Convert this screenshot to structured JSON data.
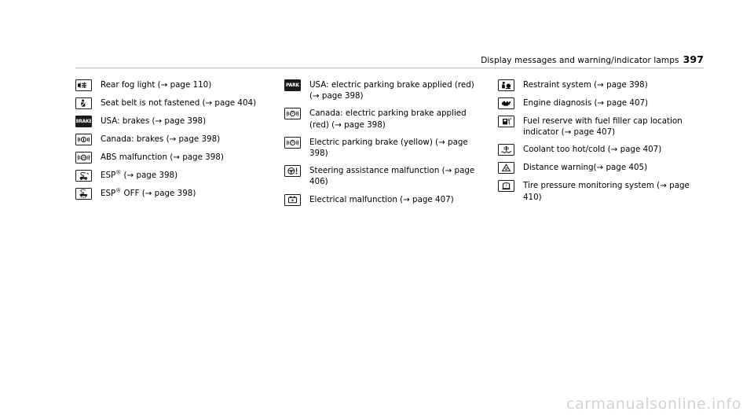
{
  "header": {
    "title": "Display messages and warning/indicator lamps",
    "page_number": "397"
  },
  "columns": [
    {
      "id": "column-1",
      "entries": [
        {
          "icon": "rear-fog-light-icon",
          "text": "Rear fog light (→ page 110)"
        },
        {
          "icon": "seat-belt-icon",
          "text": "Seat belt is not fastened (→ page 404)"
        },
        {
          "icon": "brake-text-icon",
          "text": "USA: brakes (→ page 398)"
        },
        {
          "icon": "brake-circle-icon",
          "text": "Canada: brakes (→ page 398)"
        },
        {
          "icon": "abs-icon",
          "text": "ABS malfunction (→ page 398)"
        },
        {
          "icon": "esp-icon",
          "text": "ESP® (→ page 398)",
          "sup": "®",
          "pre": "ESP",
          "post": " (→ page 398)"
        },
        {
          "icon": "esp-off-icon",
          "text": "ESP® OFF (→ page 398)",
          "sup": "®",
          "pre": "ESP",
          "post": " OFF (→ page 398)"
        }
      ]
    },
    {
      "id": "column-2",
      "entries": [
        {
          "icon": "park-brake-icon",
          "text": "USA: electric parking brake applied (red) (→ page 398)"
        },
        {
          "icon": "parking-brake-p-icon",
          "text": "Canada: electric parking brake applied (red) (→ page 398)"
        },
        {
          "icon": "parking-brake-p-yellow-icon",
          "text": "Electric parking brake (yellow) (→ page 398)"
        },
        {
          "icon": "steering-wheel-warning-icon",
          "text": "Steering assistance malfunction (→ page 406)"
        },
        {
          "icon": "electrical-malfunction-icon",
          "text": "Electrical malfunction (→ page 407)"
        }
      ]
    },
    {
      "id": "column-3",
      "entries": [
        {
          "icon": "restraint-system-icon",
          "text": "Restraint system (→ page 398)"
        },
        {
          "icon": "engine-diagnosis-icon",
          "text": "Engine diagnosis (→ page 407)"
        },
        {
          "icon": "fuel-reserve-icon",
          "text": "Fuel reserve with fuel filler cap location indicator (→ page 407)"
        },
        {
          "icon": "coolant-temperature-icon",
          "text": "Coolant too hot/cold (→ page 407)"
        },
        {
          "icon": "distance-warning-icon",
          "text": "Distance warning(→ page 405)"
        },
        {
          "icon": "tire-pressure-icon",
          "text": "Tire pressure monitoring system (→ page 410)"
        }
      ]
    }
  ],
  "watermark": "carmanualsonline.info"
}
